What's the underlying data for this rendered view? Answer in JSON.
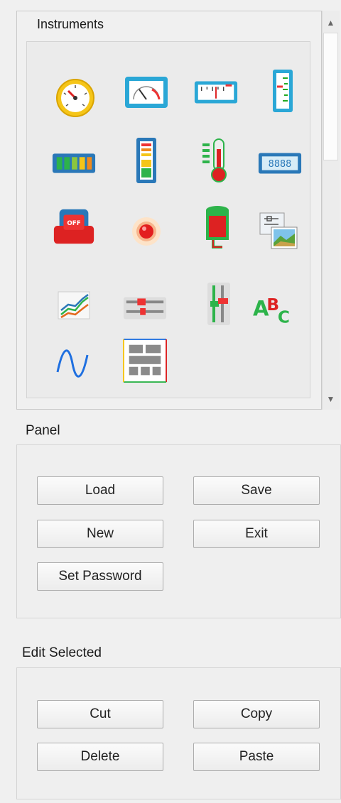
{
  "instruments": {
    "title": "Instruments",
    "icons": [
      "round-gauge-icon",
      "arc-meter-icon",
      "linear-meter-icon",
      "vertical-scale-icon",
      "battery-bar-icon",
      "vertical-level-icon",
      "thermometer-icon",
      "digital-display-icon",
      "off-switch-icon",
      "red-led-icon",
      "tank-icon",
      "image-icon",
      "line-chart-icon",
      "horizontal-slider-icon",
      "vertical-slider-icon",
      "text-label-icon",
      "sine-wave-icon",
      "grid-layout-icon"
    ]
  },
  "panel": {
    "title": "Panel",
    "load": "Load",
    "save": "Save",
    "new": "New",
    "exit": "Exit",
    "set_password": "Set Password"
  },
  "edit": {
    "title": "Edit Selected",
    "cut": "Cut",
    "copy": "Copy",
    "delete": "Delete",
    "paste": "Paste"
  },
  "scrollbar": {
    "up": "▲",
    "down": "▼"
  }
}
